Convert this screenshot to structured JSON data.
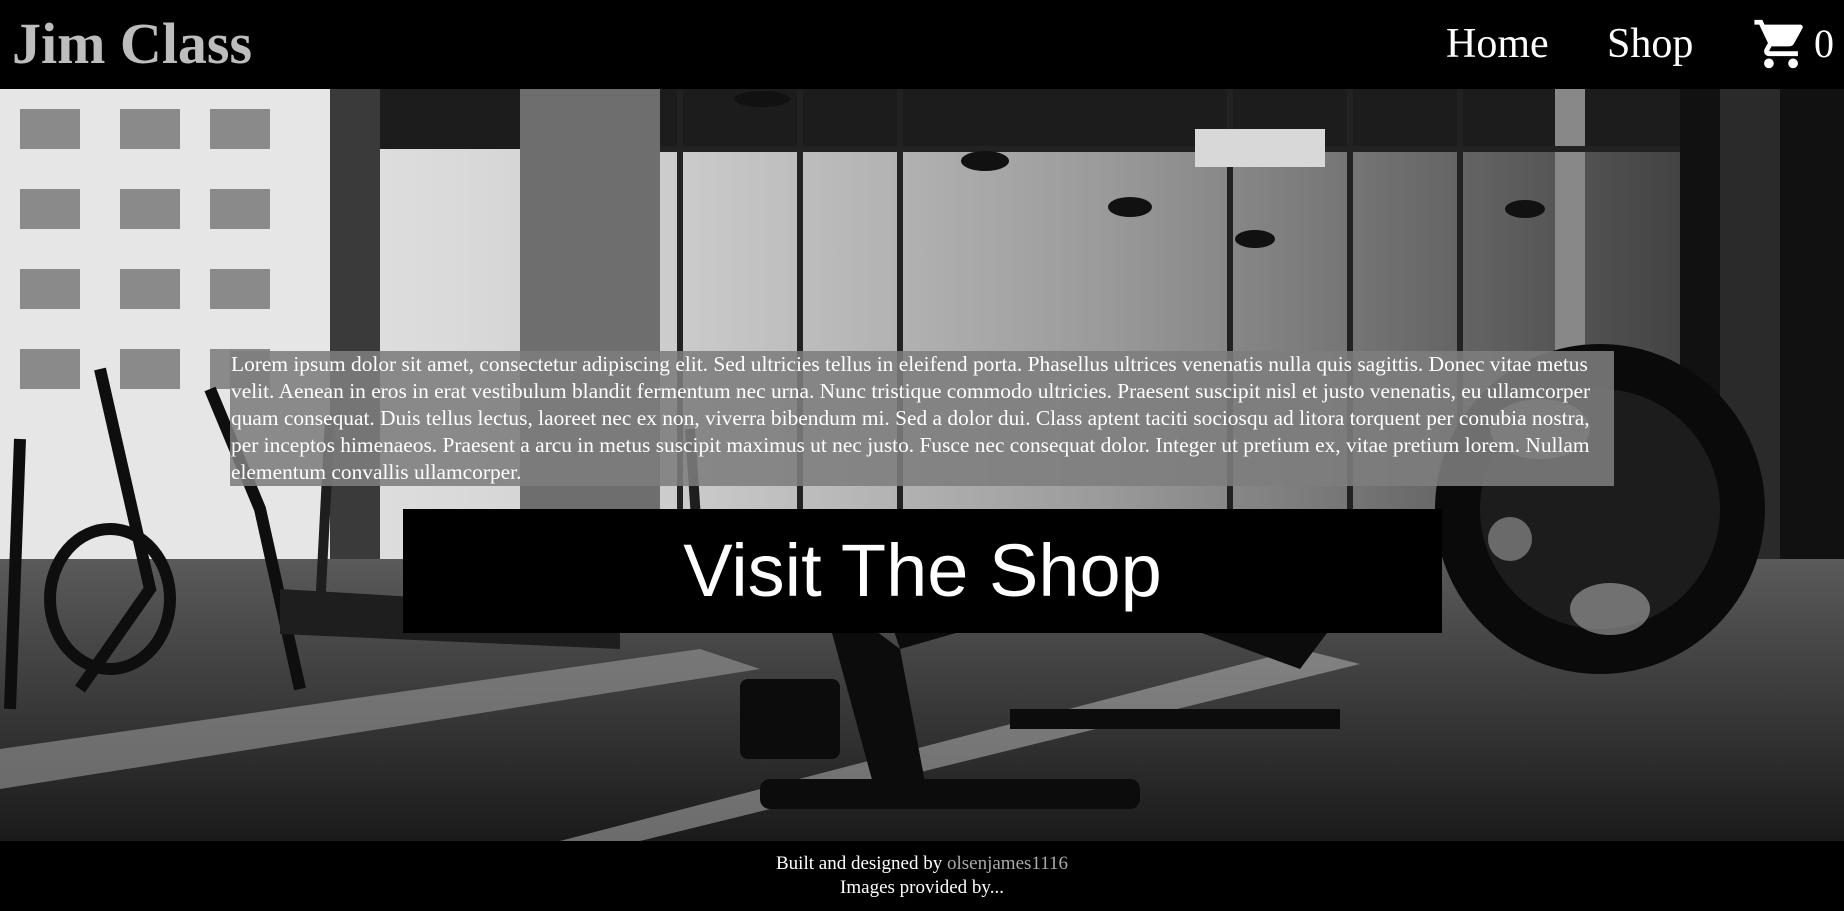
{
  "header": {
    "brand": "Jim Class",
    "nav": [
      {
        "label": "Home"
      },
      {
        "label": "Shop"
      }
    ],
    "cart_icon": "shopping-cart-icon",
    "cart_count": "0"
  },
  "hero": {
    "background_image": "gym-interior-grayscale-photo",
    "intro_text": "Lorem ipsum dolor sit amet, consectetur adipiscing elit. Sed ultricies tellus in eleifend porta. Phasellus ultrices venenatis nulla quis sagittis. Donec vitae metus velit. Aenean in eros in erat vestibulum blandit fermentum nec urna. Nunc tristique commodo ultricies. Praesent suscipit nisl et justo venenatis, eu ullamcorper quam consequat. Duis tellus lectus, laoreet nec ex non, viverra bibendum mi. Sed a dolor dui. Class aptent taciti sociosqu ad litora torquent per conubia nostra, per inceptos himenaeos. Praesent a arcu in metus suscipit maximus ut nec justo. Fusce nec consequat dolor. Integer ut pretium ex, vitae pretium lorem. Nullam elementum convallis ullamcorper.",
    "cta_label": "Visit The Shop"
  },
  "footer": {
    "built_prefix": "Built and designed by ",
    "author": "olsenjames1116",
    "images_credit": "Images provided by..."
  },
  "colors": {
    "background": "#000000",
    "brand_text": "#bdbdbd",
    "text_panel": "#7d7d7d",
    "link_muted": "#a9a9a9"
  }
}
